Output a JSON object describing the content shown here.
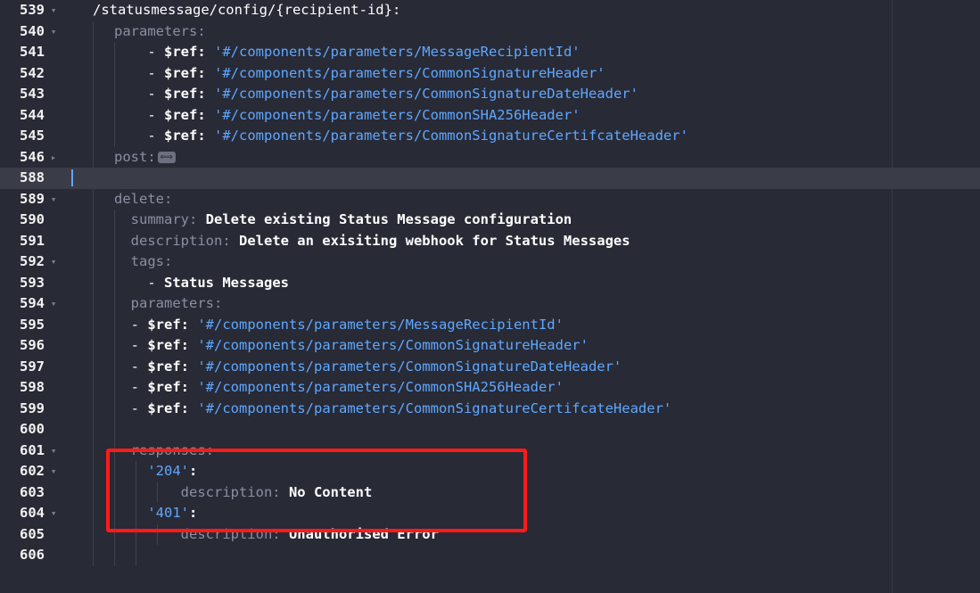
{
  "editor": {
    "lines": [
      {
        "num": "539",
        "fold": "▾",
        "segs": [
          {
            "c": "t",
            "t": "/statusmessage/config/{recipient-id}:"
          }
        ]
      },
      {
        "num": "540",
        "fold": "▾",
        "segs": [
          {
            "c": "k",
            "t": "parameters:"
          }
        ]
      },
      {
        "num": "541",
        "fold": "",
        "segs": [
          {
            "c": "t",
            "t": "    - "
          },
          {
            "c": "w",
            "t": "$ref:"
          },
          {
            "c": "t",
            "t": " "
          },
          {
            "c": "s",
            "t": "'#/components/parameters/MessageRecipientId'"
          }
        ]
      },
      {
        "num": "542",
        "fold": "",
        "segs": [
          {
            "c": "t",
            "t": "    - "
          },
          {
            "c": "w",
            "t": "$ref:"
          },
          {
            "c": "t",
            "t": " "
          },
          {
            "c": "s",
            "t": "'#/components/parameters/CommonSignatureHeader'"
          }
        ]
      },
      {
        "num": "543",
        "fold": "",
        "segs": [
          {
            "c": "t",
            "t": "    - "
          },
          {
            "c": "w",
            "t": "$ref:"
          },
          {
            "c": "t",
            "t": " "
          },
          {
            "c": "s",
            "t": "'#/components/parameters/CommonSignatureDateHeader'"
          }
        ]
      },
      {
        "num": "544",
        "fold": "",
        "segs": [
          {
            "c": "t",
            "t": "    - "
          },
          {
            "c": "w",
            "t": "$ref:"
          },
          {
            "c": "t",
            "t": " "
          },
          {
            "c": "s",
            "t": "'#/components/parameters/CommonSHA256Header'"
          }
        ]
      },
      {
        "num": "545",
        "fold": "",
        "segs": [
          {
            "c": "t",
            "t": "    - "
          },
          {
            "c": "w",
            "t": "$ref:"
          },
          {
            "c": "t",
            "t": " "
          },
          {
            "c": "s",
            "t": "'#/components/parameters/CommonSignatureCertifcateHeader'"
          }
        ]
      },
      {
        "num": "546",
        "fold": "▸",
        "segs": [
          {
            "c": "k",
            "t": "post:"
          }
        ],
        "collapsed": true
      },
      {
        "num": "588",
        "fold": "",
        "segs": [],
        "current": true
      },
      {
        "num": "589",
        "fold": "▾",
        "segs": [
          {
            "c": "k",
            "t": "delete:"
          }
        ]
      },
      {
        "num": "590",
        "fold": "",
        "segs": [
          {
            "c": "t",
            "t": "  "
          },
          {
            "c": "k",
            "t": "summary:"
          },
          {
            "c": "w",
            "t": " Delete existing Status Message configuration"
          }
        ]
      },
      {
        "num": "591",
        "fold": "",
        "segs": [
          {
            "c": "t",
            "t": "  "
          },
          {
            "c": "k",
            "t": "description:"
          },
          {
            "c": "w",
            "t": " Delete an exisiting webhook for Status Messages"
          }
        ]
      },
      {
        "num": "592",
        "fold": "▾",
        "segs": [
          {
            "c": "t",
            "t": "  "
          },
          {
            "c": "k",
            "t": "tags:"
          }
        ]
      },
      {
        "num": "593",
        "fold": "",
        "segs": [
          {
            "c": "t",
            "t": "    - "
          },
          {
            "c": "w",
            "t": "Status Messages"
          }
        ]
      },
      {
        "num": "594",
        "fold": "▾",
        "segs": [
          {
            "c": "t",
            "t": "  "
          },
          {
            "c": "k",
            "t": "parameters:"
          }
        ]
      },
      {
        "num": "595",
        "fold": "",
        "segs": [
          {
            "c": "t",
            "t": "  - "
          },
          {
            "c": "w",
            "t": "$ref:"
          },
          {
            "c": "t",
            "t": " "
          },
          {
            "c": "s",
            "t": "'#/components/parameters/MessageRecipientId'"
          }
        ]
      },
      {
        "num": "596",
        "fold": "",
        "segs": [
          {
            "c": "t",
            "t": "  - "
          },
          {
            "c": "w",
            "t": "$ref:"
          },
          {
            "c": "t",
            "t": " "
          },
          {
            "c": "s",
            "t": "'#/components/parameters/CommonSignatureHeader'"
          }
        ]
      },
      {
        "num": "597",
        "fold": "",
        "segs": [
          {
            "c": "t",
            "t": "  - "
          },
          {
            "c": "w",
            "t": "$ref:"
          },
          {
            "c": "t",
            "t": " "
          },
          {
            "c": "s",
            "t": "'#/components/parameters/CommonSignatureDateHeader'"
          }
        ]
      },
      {
        "num": "598",
        "fold": "",
        "segs": [
          {
            "c": "t",
            "t": "  - "
          },
          {
            "c": "w",
            "t": "$ref:"
          },
          {
            "c": "t",
            "t": " "
          },
          {
            "c": "s",
            "t": "'#/components/parameters/CommonSHA256Header'"
          }
        ]
      },
      {
        "num": "599",
        "fold": "",
        "segs": [
          {
            "c": "t",
            "t": "  - "
          },
          {
            "c": "w",
            "t": "$ref:"
          },
          {
            "c": "t",
            "t": " "
          },
          {
            "c": "s",
            "t": "'#/components/parameters/CommonSignatureCertifcateHeader'"
          }
        ]
      },
      {
        "num": "600",
        "fold": "",
        "segs": []
      },
      {
        "num": "601",
        "fold": "▾",
        "segs": [
          {
            "c": "t",
            "t": "  "
          },
          {
            "c": "k",
            "t": "responses:"
          }
        ]
      },
      {
        "num": "602",
        "fold": "▾",
        "segs": [
          {
            "c": "t",
            "t": "    "
          },
          {
            "c": "s",
            "t": "'204'"
          },
          {
            "c": "w",
            "t": ":"
          }
        ]
      },
      {
        "num": "603",
        "fold": "",
        "segs": [
          {
            "c": "t",
            "t": "        "
          },
          {
            "c": "k",
            "t": "description:"
          },
          {
            "c": "w",
            "t": " No Content"
          }
        ]
      },
      {
        "num": "604",
        "fold": "▾",
        "segs": [
          {
            "c": "t",
            "t": "    "
          },
          {
            "c": "s",
            "t": "'401'"
          },
          {
            "c": "w",
            "t": ":"
          }
        ]
      },
      {
        "num": "605",
        "fold": "",
        "segs": [
          {
            "c": "t",
            "t": "        "
          },
          {
            "c": "k",
            "t": "description:"
          },
          {
            "c": "w",
            "t": " Unauthorised Error"
          }
        ]
      },
      {
        "num": "606",
        "fold": "",
        "segs": []
      }
    ],
    "collapsed_marker": "⟺"
  },
  "colors": {
    "background": "#282a36",
    "key": "#8b8fa0",
    "string": "#5fa8ff",
    "value": "#ffffff",
    "highlight_box": "#ff1a1a"
  }
}
